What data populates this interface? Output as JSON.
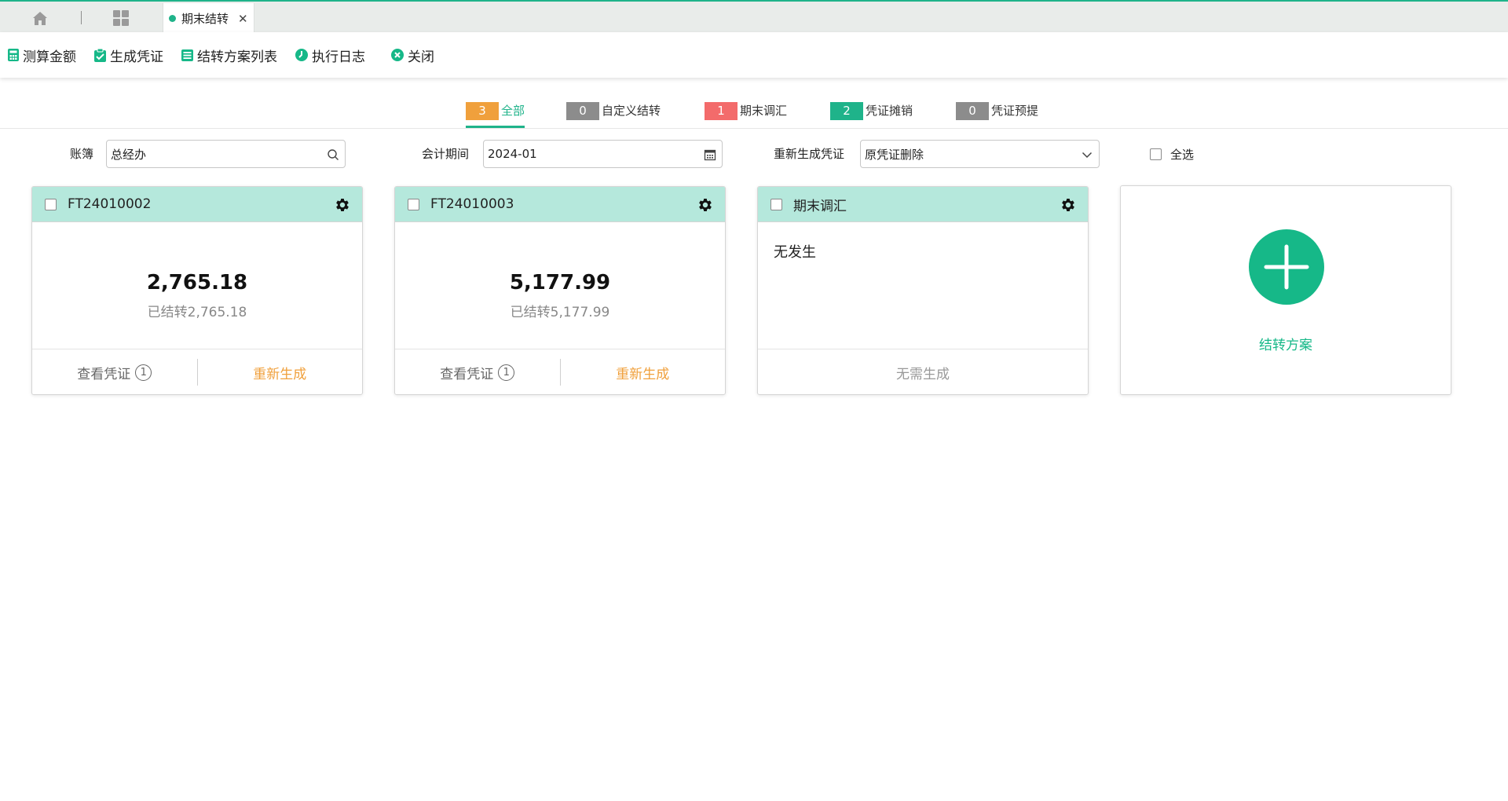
{
  "tabs": {
    "home_icon": "home-icon",
    "apps_icon": "grid-icon",
    "active": {
      "label": "期末结转",
      "close": "✕"
    }
  },
  "toolbar": {
    "calc_label": "测算金额",
    "generate_label": "生成凭证",
    "plan_list_label": "结转方案列表",
    "log_label": "执行日志",
    "close_label": "关闭"
  },
  "filter_tabs": [
    {
      "count": "3",
      "label": "全部",
      "color": "#f0a03c",
      "active": true
    },
    {
      "count": "0",
      "label": "自定义结转",
      "color": "#8c8c8c",
      "active": false
    },
    {
      "count": "1",
      "label": "期末调汇",
      "color": "#f36b6b",
      "active": false
    },
    {
      "count": "2",
      "label": "凭证摊销",
      "color": "#1fb38a",
      "active": false
    },
    {
      "count": "0",
      "label": "凭证预提",
      "color": "#8c8c8c",
      "active": false
    }
  ],
  "filters": {
    "ledger_label": "账簿",
    "ledger_value": "总经办",
    "period_label": "会计期间",
    "period_value": "2024-01",
    "regen_label": "重新生成凭证",
    "regen_value": "原凭证删除",
    "select_all": "全选"
  },
  "cards": [
    {
      "title": "FT24010002",
      "amount": "2,765.18",
      "sub": "已结转2,765.18",
      "view_label": "查看凭证",
      "view_count": "1",
      "regen_label": "重新生成"
    },
    {
      "title": "FT24010003",
      "amount": "5,177.99",
      "sub": "已结转5,177.99",
      "view_label": "查看凭证",
      "view_count": "1",
      "regen_label": "重新生成"
    },
    {
      "title": "期末调汇",
      "empty_text": "无发生",
      "none_label": "无需生成"
    }
  ],
  "add_card": {
    "label": "结转方案"
  },
  "colors": {
    "accent": "#1fb38a",
    "card_header": "#b5e8dc",
    "regen": "#f0a03c"
  }
}
